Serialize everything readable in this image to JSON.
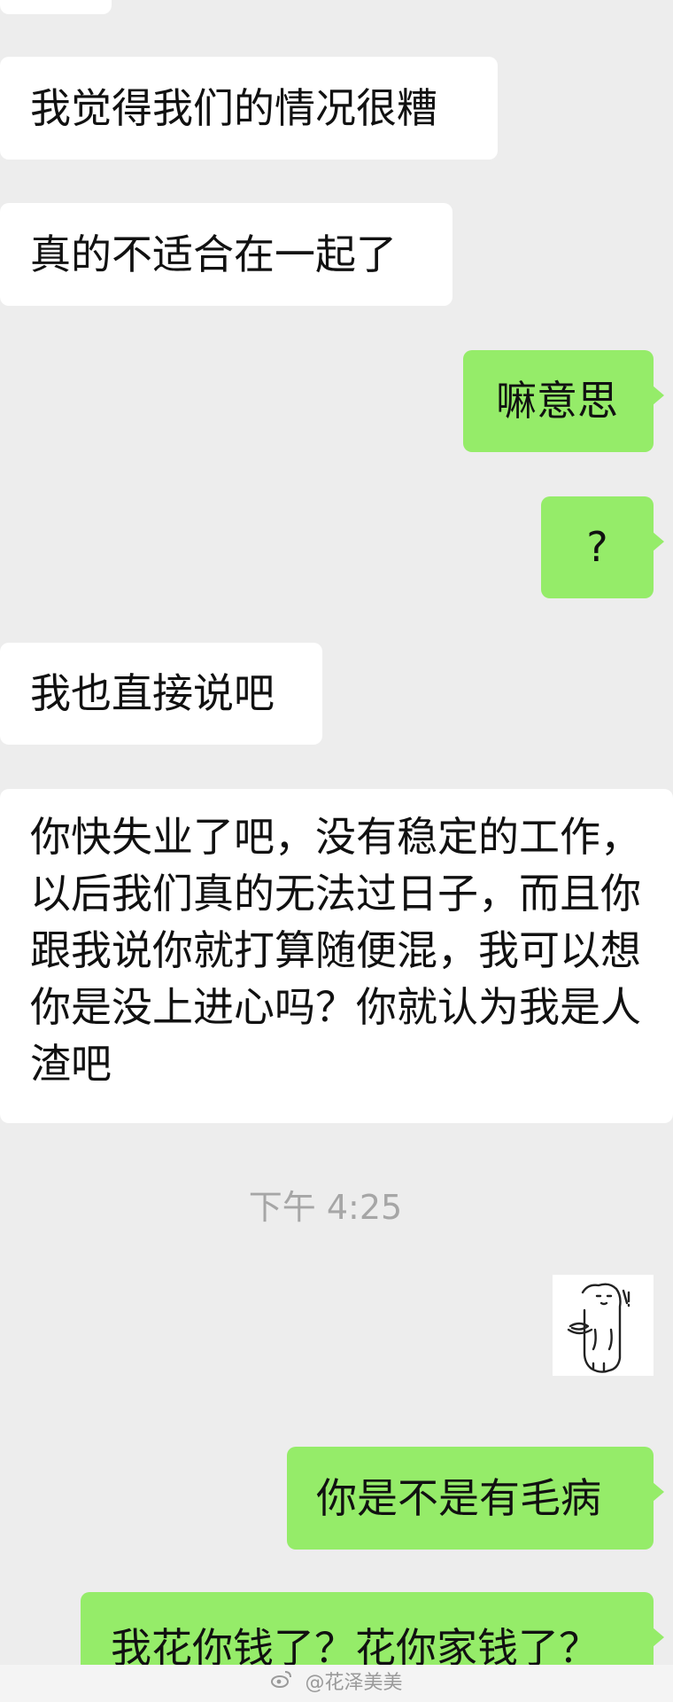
{
  "messages": [
    {
      "side": "in",
      "text": "我觉得我们的情况很糟"
    },
    {
      "side": "in",
      "text": "真的不适合在一起了"
    },
    {
      "side": "out",
      "text": "嘛意思"
    },
    {
      "side": "out",
      "text": "?"
    },
    {
      "side": "in",
      "text": "我也直接说吧"
    },
    {
      "side": "in",
      "text": "你快失业了吧，没有稳定的工作，以后我们真的无法过日子，而且你跟我说你就打算随便混，我可以想你是没上进心吗？你就认为我是人渣吧"
    },
    {
      "side": "out",
      "text": "你是不是有毛病"
    },
    {
      "side": "out",
      "text": "我花你钱了？花你家钱了？"
    }
  ],
  "timestamp": "下午 4:25",
  "sticker": {
    "icon": "cat-sticker-icon"
  },
  "watermark": {
    "text": "@花泽美美",
    "icon": "weibo-icon"
  },
  "colors": {
    "background": "#ededed",
    "incoming_bubble": "#ffffff",
    "outgoing_bubble": "#95ec69",
    "text": "#111111",
    "timestamp": "#a6a6a6"
  }
}
